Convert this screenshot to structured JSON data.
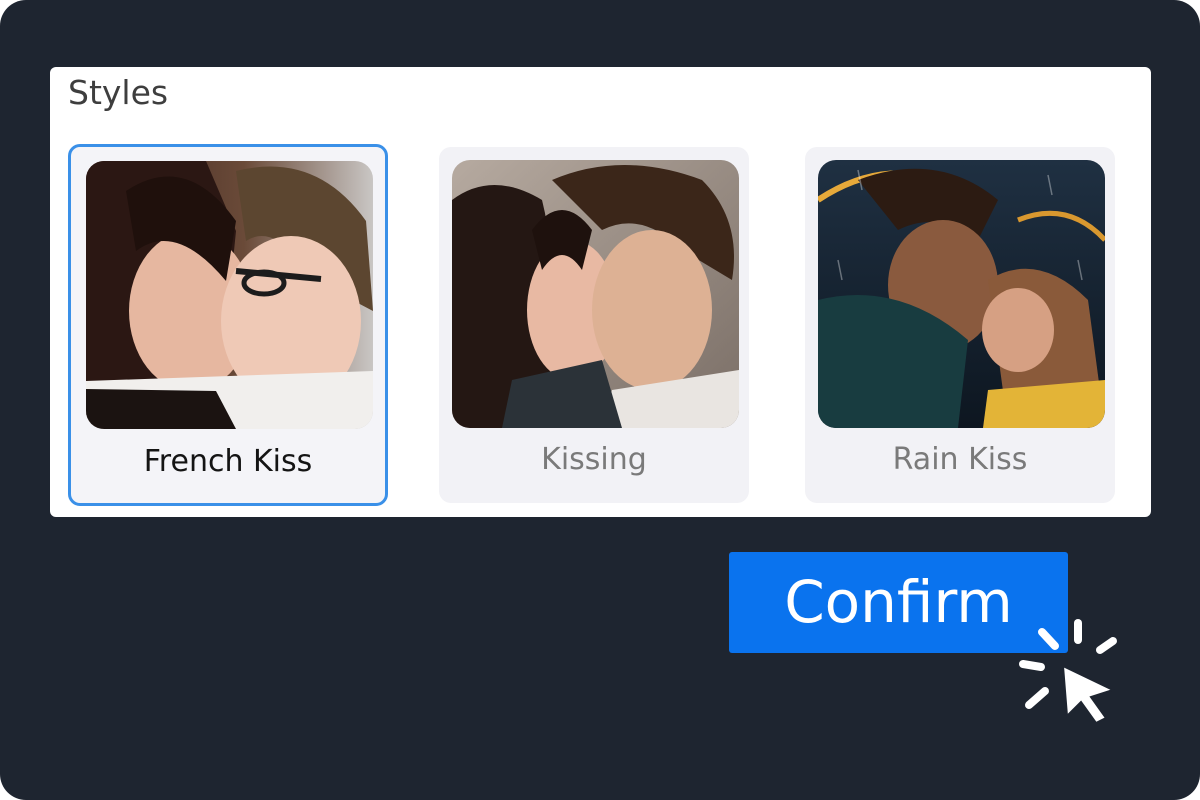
{
  "panel": {
    "title": "Styles"
  },
  "styles": [
    {
      "label": "French Kiss",
      "selected": true
    },
    {
      "label": "Kissing",
      "selected": false
    },
    {
      "label": "Rain Kiss",
      "selected": false
    }
  ],
  "confirm_label": "Confirm",
  "colors": {
    "background": "#1e2530",
    "panel": "#ffffff",
    "card": "#f2f2f6",
    "selected_border": "#3a90e8",
    "confirm": "#0a73ee",
    "cursor": "#ffffff"
  },
  "icons": {
    "cursor": "pointer-click-icon"
  }
}
